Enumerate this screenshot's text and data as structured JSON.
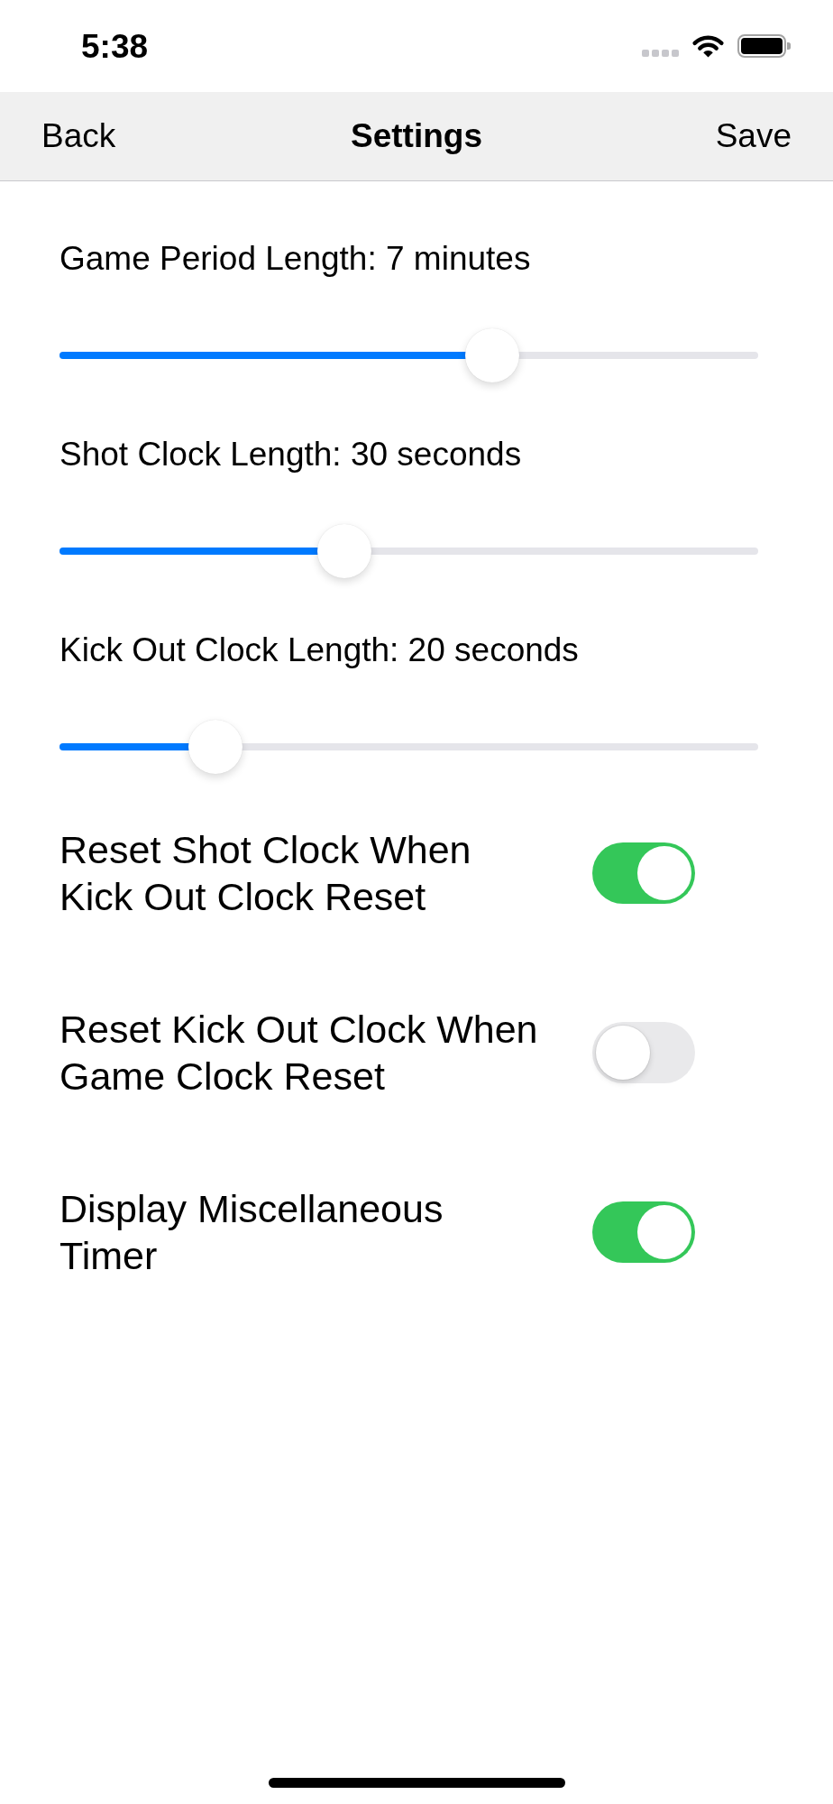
{
  "status_bar": {
    "time": "5:38"
  },
  "nav_bar": {
    "back": "Back",
    "title": "Settings",
    "save": "Save"
  },
  "sliders": [
    {
      "label": "Game Period Length: 7 minutes",
      "level": 0.63
    },
    {
      "label": "Shot Clock Length: 30 seconds",
      "level": 0.4
    },
    {
      "label": "Kick Out Clock Length: 20 seconds",
      "level": 0.2
    }
  ],
  "toggles": [
    {
      "lines": [
        "Reset Shot Clock When",
        "Kick Out Clock Reset"
      ],
      "on": true
    },
    {
      "lines": [
        "Reset Kick Out Clock When",
        "Game Clock Reset"
      ],
      "on": false
    },
    {
      "lines": [
        "Display Miscellaneous",
        "Timer"
      ],
      "on": true
    }
  ]
}
